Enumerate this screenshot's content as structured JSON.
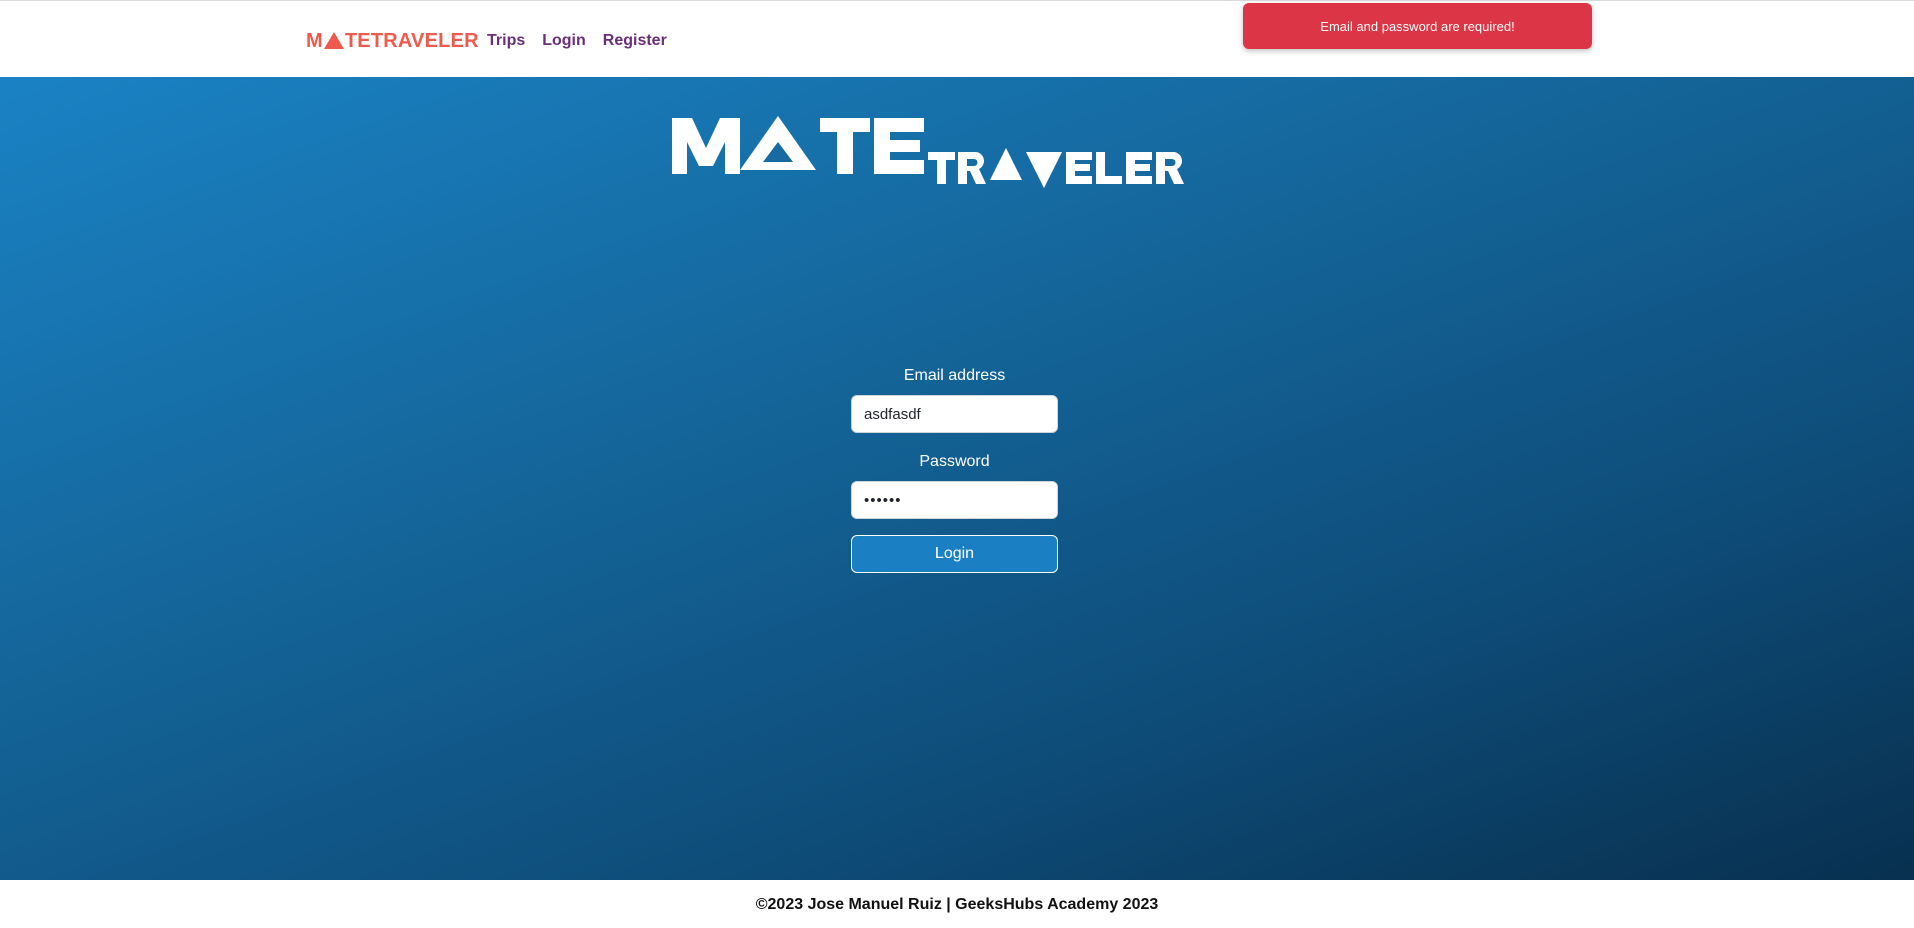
{
  "nav": {
    "brand": "M▲TETRAVELER",
    "brand_prefix": "M",
    "brand_suffix": "TETRAVELER",
    "links": [
      "Trips",
      "Login",
      "Register"
    ]
  },
  "toast": {
    "message": "Email and password are required!"
  },
  "hero": {
    "logo_text": "MATETRAVELER"
  },
  "login_form": {
    "email_label": "Email address",
    "email_value": "asdfasdf",
    "password_label": "Password",
    "password_value": "••••••",
    "submit_label": "Login"
  },
  "footer": {
    "text": "©2023 Jose Manuel Ruiz | GeeksHubs Academy 2023"
  },
  "colors": {
    "brand": "#ef5a4f",
    "nav_link": "#6b2e7a",
    "toast_bg": "#dc3545",
    "hero_gradient_start": "#1a82c4",
    "hero_gradient_end": "#08304f",
    "button_bg": "#1a7fc3"
  }
}
